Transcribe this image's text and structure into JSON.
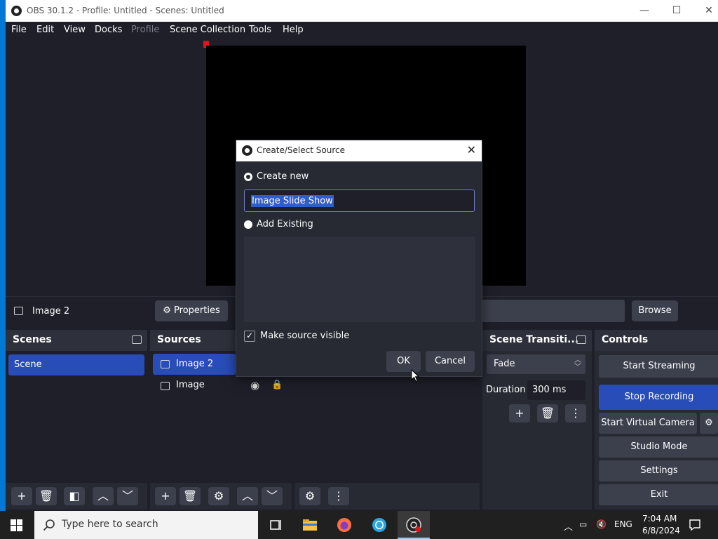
{
  "window": {
    "title": "OBS 30.1.2 - Profile: Untitled - Scenes: Untitled",
    "min_glyph": "—",
    "max_glyph": "☐",
    "close_glyph": "✕"
  },
  "menu": [
    "File",
    "Edit",
    "View",
    "Docks",
    "Profile",
    "Scene Collection",
    "Tools",
    "Help"
  ],
  "source_bar": {
    "selected_source": "Image 2",
    "properties_label": "Properties",
    "browse_label": "Browse"
  },
  "docks": {
    "scenes": {
      "title": "Scenes",
      "items": [
        "Scene"
      ]
    },
    "sources": {
      "title": "Sources",
      "items": [
        "Image 2",
        "Image"
      ]
    },
    "transitions": {
      "title": "Scene Transiti...",
      "value": "Fade",
      "duration_label": "Duration",
      "duration_value": "300 ms"
    },
    "controls": {
      "title": "Controls",
      "buttons": [
        "Start Streaming",
        "Stop Recording",
        "Start Virtual Camera",
        "Studio Mode",
        "Settings",
        "Exit"
      ]
    }
  },
  "dialog": {
    "title": "Create/Select Source",
    "create_new_label": "Create new",
    "name_value": "Image Slide Show",
    "add_existing_label": "Add Existing",
    "visible_label": "Make source visible",
    "visible_checked": true,
    "ok_label": "OK",
    "cancel_label": "Cancel"
  },
  "taskbar": {
    "search_placeholder": "Type here to search",
    "language": "ENG",
    "time": "7:04 AM",
    "date": "6/8/2024"
  },
  "colors": {
    "accent": "#284cb8",
    "panel": "#272a33",
    "background": "#1e1f29"
  }
}
